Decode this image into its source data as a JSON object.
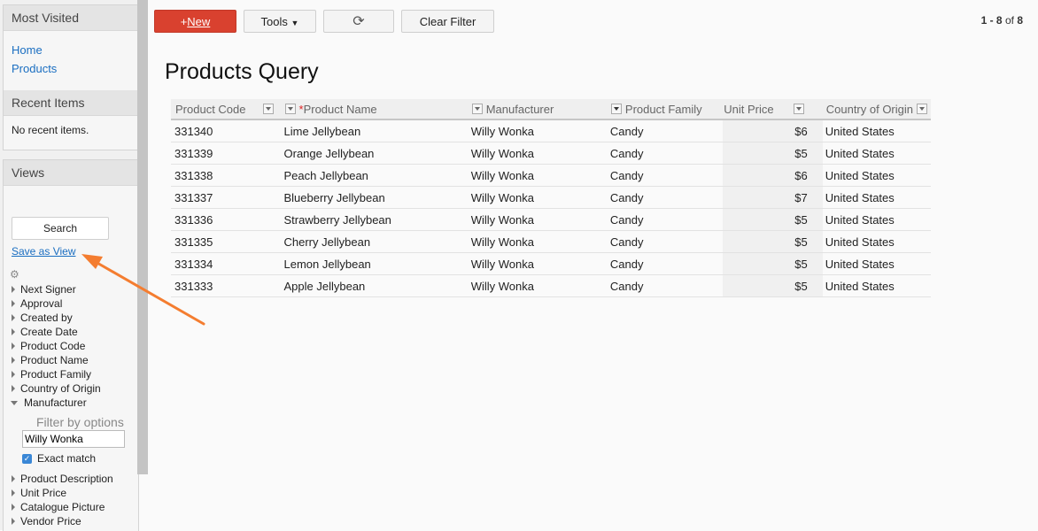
{
  "sidebar": {
    "most_visited_title": "Most Visited",
    "links": [
      "Home",
      "Products"
    ],
    "recent_title": "Recent Items",
    "recent_empty": "No recent items.",
    "views_title": "Views",
    "search_label": "Search",
    "save_view_label": "Save as View",
    "fields_before": [
      "Next Signer",
      "Approval",
      "Created by",
      "Create Date",
      "Product Code",
      "Product Name",
      "Product Family",
      "Country of Origin"
    ],
    "expanded_field": "Manufacturer",
    "filter_label": "Filter by options",
    "filter_value": "Willy Wonka",
    "exact_match_label": "Exact match",
    "exact_match_checked": true,
    "fields_after": [
      "Product Description",
      "Unit Price",
      "Catalogue Picture",
      "Vendor Price"
    ]
  },
  "toolbar": {
    "new_plus": "+",
    "new_label": "New",
    "tools_label": "Tools",
    "refresh_icon": "refresh-icon",
    "clear_filter_label": "Clear Filter",
    "paging_range": "1 - 8",
    "paging_of": "of",
    "paging_total": "8"
  },
  "page_title": "Products Query",
  "table": {
    "columns": [
      {
        "label": "Product Code",
        "required": false,
        "filtered": false
      },
      {
        "label": "Product Name",
        "required": true,
        "filtered": false
      },
      {
        "label": "Manufacturer",
        "required": false,
        "filtered": false
      },
      {
        "label": "Product Family",
        "required": false,
        "filtered": true
      },
      {
        "label": "Unit Price",
        "required": false,
        "filtered": false
      },
      {
        "label": "Country of Origin",
        "required": false,
        "filtered": false
      }
    ],
    "rows": [
      [
        "331340",
        "Lime Jellybean",
        "Willy Wonka",
        "Candy",
        "$6",
        "United States"
      ],
      [
        "331339",
        "Orange Jellybean",
        "Willy Wonka",
        "Candy",
        "$5",
        "United States"
      ],
      [
        "331338",
        "Peach Jellybean",
        "Willy Wonka",
        "Candy",
        "$6",
        "United States"
      ],
      [
        "331337",
        "Blueberry Jellybean",
        "Willy Wonka",
        "Candy",
        "$7",
        "United States"
      ],
      [
        "331336",
        "Strawberry Jellybean",
        "Willy Wonka",
        "Candy",
        "$5",
        "United States"
      ],
      [
        "331335",
        "Cherry Jellybean",
        "Willy Wonka",
        "Candy",
        "$5",
        "United States"
      ],
      [
        "331334",
        "Lemon Jellybean",
        "Willy Wonka",
        "Candy",
        "$5",
        "United States"
      ],
      [
        "331333",
        "Apple Jellybean",
        "Willy Wonka",
        "Candy",
        "$5",
        "United States"
      ]
    ]
  },
  "colors": {
    "new_button": "#d9412f",
    "link": "#1a6ec1",
    "annotation_arrow": "#f47d30"
  }
}
